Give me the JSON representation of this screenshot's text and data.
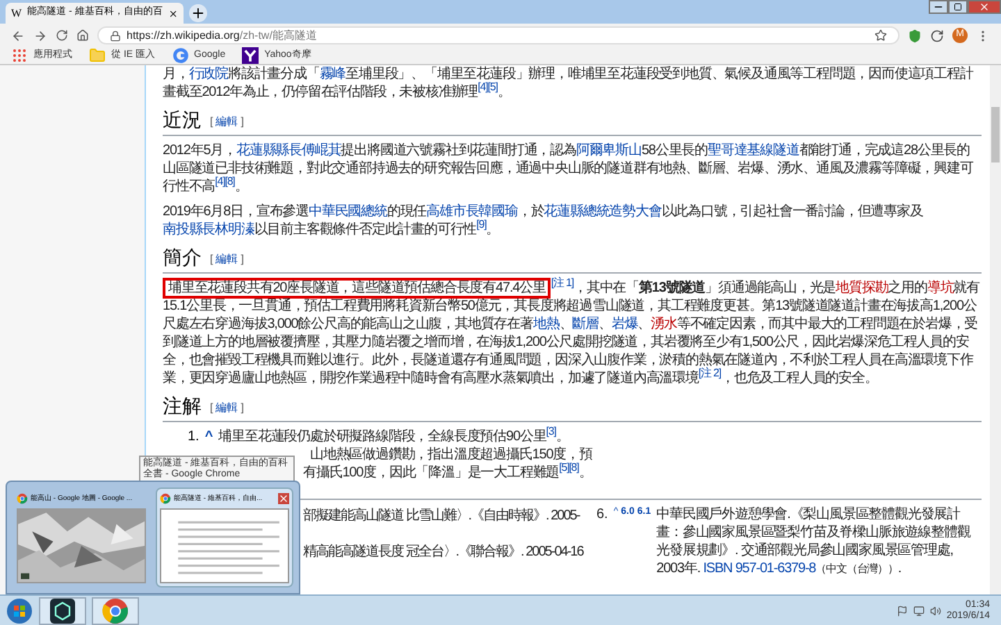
{
  "browser": {
    "favicon": "W",
    "tab_title": "能高隧道 - 維基百科，自由的百",
    "url_host": "https://zh.wikipedia.org",
    "url_path": "/zh-tw/能高隧道",
    "avatar": "M",
    "bookmarks": [
      {
        "label": "應用程式",
        "kind": "apps"
      },
      {
        "label": "從 IE 匯入",
        "kind": "folder"
      },
      {
        "label": "Google",
        "kind": "google"
      },
      {
        "label": "Yahoo奇摩",
        "kind": "yahoo"
      }
    ]
  },
  "article": {
    "blocks": [
      {
        "kind": "paragraph",
        "segments": [
          {
            "kind": "text",
            "text": "月，"
          },
          {
            "kind": "link",
            "text": "行政院"
          },
          {
            "kind": "text",
            "text": "將該計畫分成「"
          },
          {
            "kind": "link",
            "text": "霧峰"
          },
          {
            "kind": "text",
            "text": "至埔里段」、「埔里至花蓮段」辦理，唯埔里至花蓮段受到地質、氣候及通風等工程問題，因而使這項工程計畫截至2012年為止，仍停留在評估階段，未被核准辦理"
          },
          {
            "kind": "ref",
            "text": "[4][5]"
          },
          {
            "kind": "text",
            "text": "。"
          }
        ]
      },
      {
        "kind": "heading",
        "title": "近況",
        "edit": {
          "open": "[",
          "label": "編輯",
          "close": "]"
        }
      },
      {
        "kind": "paragraph",
        "segments": [
          {
            "kind": "text",
            "text": "2012年5月，"
          },
          {
            "kind": "link",
            "text": "花蓮縣縣長傅崐萁"
          },
          {
            "kind": "text",
            "text": "提出將國道六號霧社到花蓮間打通，認為"
          },
          {
            "kind": "link",
            "text": "阿爾卑斯山"
          },
          {
            "kind": "text",
            "text": "58公里長的"
          },
          {
            "kind": "link",
            "text": "聖哥達基線隧道"
          },
          {
            "kind": "text",
            "text": "都能打通，完成這28公里長的山區隧道已非技術難題，對此交通部持過去的研究報告回應，通過中央山脈的隧道群有地熱、斷層、岩爆、湧水、通風及濃霧等障礙，興建可行性不高"
          },
          {
            "kind": "ref",
            "text": "[4][8]"
          },
          {
            "kind": "text",
            "text": "。"
          }
        ]
      },
      {
        "kind": "paragraph",
        "segments": [
          {
            "kind": "text",
            "text": "2019年6月8日，宣布參選"
          },
          {
            "kind": "link",
            "text": "中華民國總統"
          },
          {
            "kind": "text",
            "text": "的現任"
          },
          {
            "kind": "link",
            "text": "高雄市長韓國瑜"
          },
          {
            "kind": "text",
            "text": "，於"
          },
          {
            "kind": "link",
            "text": "花蓮縣總統造勢大會"
          },
          {
            "kind": "text",
            "text": "以此為口號，引起社會一番討論，但遭專家及"
          },
          {
            "kind": "link",
            "text": "南投縣長林明溱"
          },
          {
            "kind": "text",
            "text": "以目前主客觀條件否定此計畫的可行性"
          },
          {
            "kind": "ref",
            "text": "[9]"
          },
          {
            "kind": "text",
            "text": "。"
          }
        ]
      },
      {
        "kind": "heading",
        "title": "簡介",
        "edit": {
          "open": "[",
          "label": "編輯",
          "close": "]"
        }
      },
      {
        "kind": "paragraph",
        "segments": [
          {
            "kind": "highlight",
            "text": "埔里至花蓮段共有20座長隧道，這些隧道預估總合長度有47.4公里"
          },
          {
            "kind": "ref",
            "text": "[注 1]"
          },
          {
            "kind": "text",
            "text": "，其中在「"
          },
          {
            "kind": "bold",
            "text": "第13號隧道"
          },
          {
            "kind": "text",
            "text": "」須通過能高山，光是"
          },
          {
            "kind": "redlink",
            "text": "地質探勘"
          },
          {
            "kind": "text",
            "text": "之用的"
          },
          {
            "kind": "redlink",
            "text": "導坑"
          },
          {
            "kind": "text",
            "text": "就有15.1公里長，一旦貫通，預估工程費用將耗資新台幣50億元，其長度將超過雪山隧道，其工程難度更甚。第13號隧道隧道計畫在海拔高1,200公尺處左右穿過海拔3,000餘公尺高的能高山之山腹，其地質存在著"
          },
          {
            "kind": "link",
            "text": "地熱"
          },
          {
            "kind": "text",
            "text": "、"
          },
          {
            "kind": "link",
            "text": "斷層"
          },
          {
            "kind": "text",
            "text": "、"
          },
          {
            "kind": "link",
            "text": "岩爆"
          },
          {
            "kind": "text",
            "text": "、"
          },
          {
            "kind": "redlink",
            "text": "湧水"
          },
          {
            "kind": "text",
            "text": "等不確定因素，而其中最大的工程問題在於岩爆，受到隧道上方的地層被覆擠壓，其壓力隨岩覆之增而增，在海拔1,200公尺處開挖隧道，其岩覆將至少有1,500公尺，因此岩爆深危工程人員的安全，也會摧毀工程機具而難以進行。此外，長隧道還存有通風問題，因深入山腹作業，淤積的熱氣在隧道內，不利於工程人員在高溫環境下作業，更因穿過廬山地熱區，開挖作業過程中隨時會有高壓水蒸氣噴出，加遽了隧道內高溫環境"
          },
          {
            "kind": "ref",
            "text": "[注 2]"
          },
          {
            "kind": "text",
            "text": "，也危及工程人員的安全。"
          }
        ]
      },
      {
        "kind": "heading",
        "title": "注解",
        "edit": {
          "open": "[",
          "label": "編輯",
          "close": "]"
        }
      }
    ],
    "notes": [
      {
        "number": "1.",
        "caret": "^",
        "segments": [
          {
            "kind": "text",
            "text": "埔里至花蓮段仍處於研擬路線階段，全線長度預估90公里"
          },
          {
            "kind": "ref",
            "text": "[3]"
          },
          {
            "kind": "text",
            "text": "。"
          }
        ]
      }
    ],
    "note_fragments": [
      {
        "segments": [
          {
            "kind": "text",
            "text": "山地熱區做過鑽勘，指出溫度超過攝氏150度，預"
          }
        ]
      },
      {
        "segments": [
          {
            "kind": "text",
            "text": "有攝氏100度，因此「降溫」是一大工程難題"
          },
          {
            "kind": "ref",
            "text": "[5][8]"
          },
          {
            "kind": "text",
            "text": "。"
          }
        ]
      }
    ],
    "reference_fragments": [
      "部擬建能高山隧道 比雪山難〉.《自由時報》. 2005-",
      "精高能高隧道長度 冠全台〉.《聯合報》. 2005-04-16"
    ],
    "reference_6": {
      "number": "6.",
      "caret": "^",
      "backlinks": [
        "6.0",
        "6.1"
      ],
      "segments": [
        {
          "kind": "text",
          "text": "中華民國戶外遊憩學會.《梨山風景區整體觀光發展計畫：參山國家風景區暨梨竹苗及脊樑山脈旅遊線整體觀光發展規劃》. 交通部觀光局參山國家風景區管理處, 2003年. "
        },
        {
          "kind": "link",
          "text": "ISBN 957-01-6379-8"
        },
        {
          "kind": "small",
          "text": "（中文（台灣））"
        },
        {
          "kind": "text",
          "text": "."
        }
      ]
    }
  },
  "tooltip": "能高隧道 - 維基百科，自由的百科全書 - Google Chrome",
  "thumbnails": [
    {
      "title": "能高山 - Google 地圖 - Google ...",
      "kind": "map",
      "selected": false
    },
    {
      "title": "能高隧道 - 維基百科，自由...",
      "kind": "page",
      "selected": true
    }
  ],
  "taskbar": {
    "apps": [
      {
        "kind": "nox"
      },
      {
        "kind": "chrome"
      }
    ],
    "time": "01:34",
    "date": "2019/6/14"
  }
}
